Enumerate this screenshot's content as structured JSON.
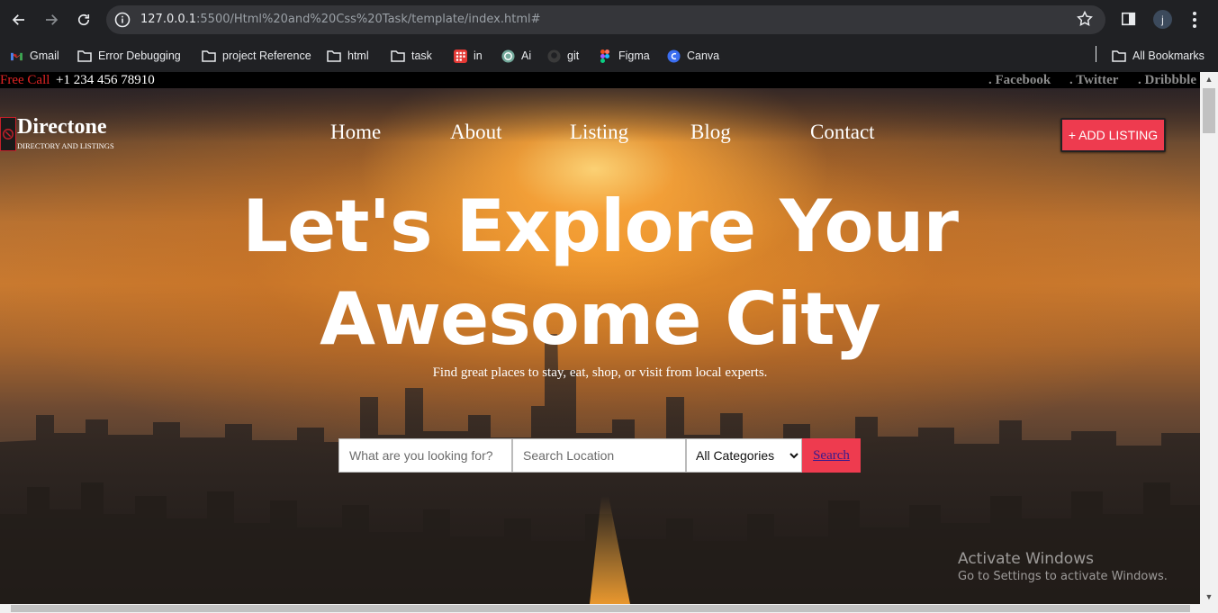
{
  "browser": {
    "url_host": "127.0.0.1",
    "url_rest": ":5500/Html%20and%20Css%20Task/template/index.html#",
    "profile_initial": "j",
    "bookmarks": [
      {
        "label": "Gmail",
        "icon": "gmail-icon"
      },
      {
        "label": "Error Debugging",
        "icon": "folder-icon"
      },
      {
        "label": "project Reference",
        "icon": "folder-icon"
      },
      {
        "label": "html",
        "icon": "folder-icon"
      },
      {
        "label": "task",
        "icon": "folder-icon"
      },
      {
        "label": "in",
        "icon": "app-grid-icon"
      },
      {
        "label": "Ai",
        "icon": "openai-icon"
      },
      {
        "label": "git",
        "icon": "github-icon"
      },
      {
        "label": "Figma",
        "icon": "figma-icon"
      },
      {
        "label": "Canva",
        "icon": "canva-icon"
      }
    ],
    "all_bookmarks": "All Bookmarks"
  },
  "topbar": {
    "free_call": "Free Call",
    "phone": "+1 234 456 78910",
    "social": [
      ". Facebook",
      ". Twitter",
      ". Dribbble"
    ]
  },
  "header": {
    "logo_name": "Directone",
    "logo_tagline": "DIRECTORY AND LISTINGS",
    "menu": [
      "Home",
      "About",
      "Listing",
      "Blog",
      "Contact"
    ],
    "add_listing": "+ ADD LISTING"
  },
  "hero": {
    "headline_line1": "Let's Explore Your",
    "headline_line2": "Awesome City",
    "subline": "Find great places to stay, eat, shop, or visit from local experts."
  },
  "search": {
    "what_placeholder": "What are you looking for?",
    "location_placeholder": "Search Location",
    "category_selected": "All Categories",
    "button": "Search"
  },
  "watermark": {
    "title": "Activate Windows",
    "subtitle": "Go to Settings to activate Windows."
  },
  "colors": {
    "accent": "#ee3b4f",
    "topbar_red": "#e02424",
    "chrome_bg": "#202124"
  }
}
